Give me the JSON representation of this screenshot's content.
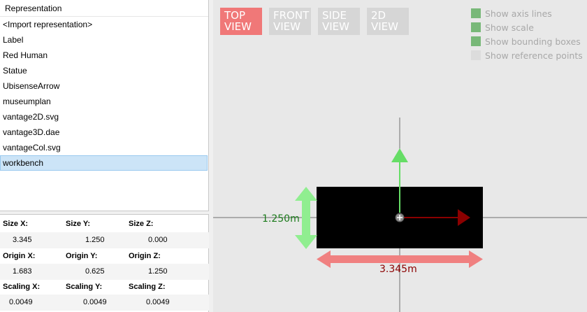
{
  "list": {
    "header": "Representation",
    "items": [
      "<Import representation>",
      "Label",
      "Red Human",
      "Statue",
      "UbisenseArrow",
      "museumplan",
      "vantage2D.svg",
      "vantage3D.dae",
      "vantageCol.svg",
      "workbench"
    ],
    "selected_index": 9
  },
  "properties": {
    "size": {
      "label_x": "Size X:",
      "label_y": "Size Y:",
      "label_z": "Size Z:",
      "x": "3.345",
      "y": "1.250",
      "z": "0.000"
    },
    "origin": {
      "label_x": "Origin X:",
      "label_y": "Origin Y:",
      "label_z": "Origin Z:",
      "x": "1.683",
      "y": "0.625",
      "z": "1.250"
    },
    "scaling": {
      "label_x": "Scaling X:",
      "label_y": "Scaling Y:",
      "label_z": "Scaling Z:",
      "x": "0.0049",
      "y": "0.0049",
      "z": "0.0049"
    }
  },
  "view_buttons": [
    {
      "line1": "TOP",
      "line2": "VIEW",
      "active": true
    },
    {
      "line1": "FRONT",
      "line2": "VIEW",
      "active": false
    },
    {
      "line1": "SIDE",
      "line2": "VIEW",
      "active": false
    },
    {
      "line1": "2D",
      "line2": "VIEW",
      "active": false
    }
  ],
  "options": [
    {
      "label": "Show axis lines",
      "checked": true
    },
    {
      "label": "Show scale",
      "checked": true
    },
    {
      "label": "Show bounding boxes",
      "checked": true
    },
    {
      "label": "Show reference points",
      "checked": false
    }
  ],
  "scene": {
    "width_label": "3.345m",
    "height_label": "1.250m",
    "colors": {
      "object": "#000000",
      "x_axis_arrow": "#8b0000",
      "y_axis_arrow": "#66dd66",
      "width_dimension": "#f08080",
      "height_dimension": "#90ee90",
      "width_text": "#8b0000",
      "height_text": "#1a7a1a",
      "axis_lines": "#707070"
    }
  }
}
